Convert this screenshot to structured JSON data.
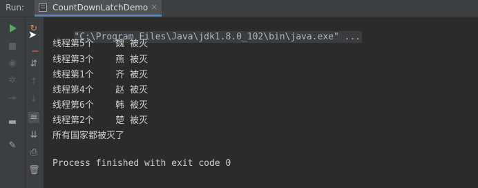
{
  "run_panel": {
    "label": "Run:",
    "tab": {
      "title": "CountDownLatchDemo",
      "close": "×"
    }
  },
  "console": {
    "command": "\"C:\\Program Files\\Java\\jdk1.8.0_102\\bin\\java.exe\" ...",
    "lines": [
      "线程第5个    魏 被灭",
      "线程第3个    燕 被灭",
      "线程第1个    齐 被灭",
      "线程第4个    赵 被灭",
      "线程第6个    韩 被灭",
      "线程第2个    楚 被灭",
      "所有国家都被灭了"
    ],
    "exit_message": "Process finished with exit code 0"
  },
  "toolbar_icons": [
    "run-icon",
    "stop-icon",
    "camera-icon",
    "settings-icon",
    "login-icon",
    "layout-icon",
    "pin-icon",
    "rerun-icon",
    "cursor-icon",
    "sort-icon",
    "up-arrow-icon",
    "down-arrow-icon",
    "soft-wrap-icon",
    "scroll-to-end-icon",
    "print-icon",
    "trash-icon"
  ],
  "colors": {
    "background": "#2b2b2b",
    "toolbar": "#3c3f41",
    "active_tab_underline": "#4a88c7",
    "run_green": "#59a869"
  }
}
